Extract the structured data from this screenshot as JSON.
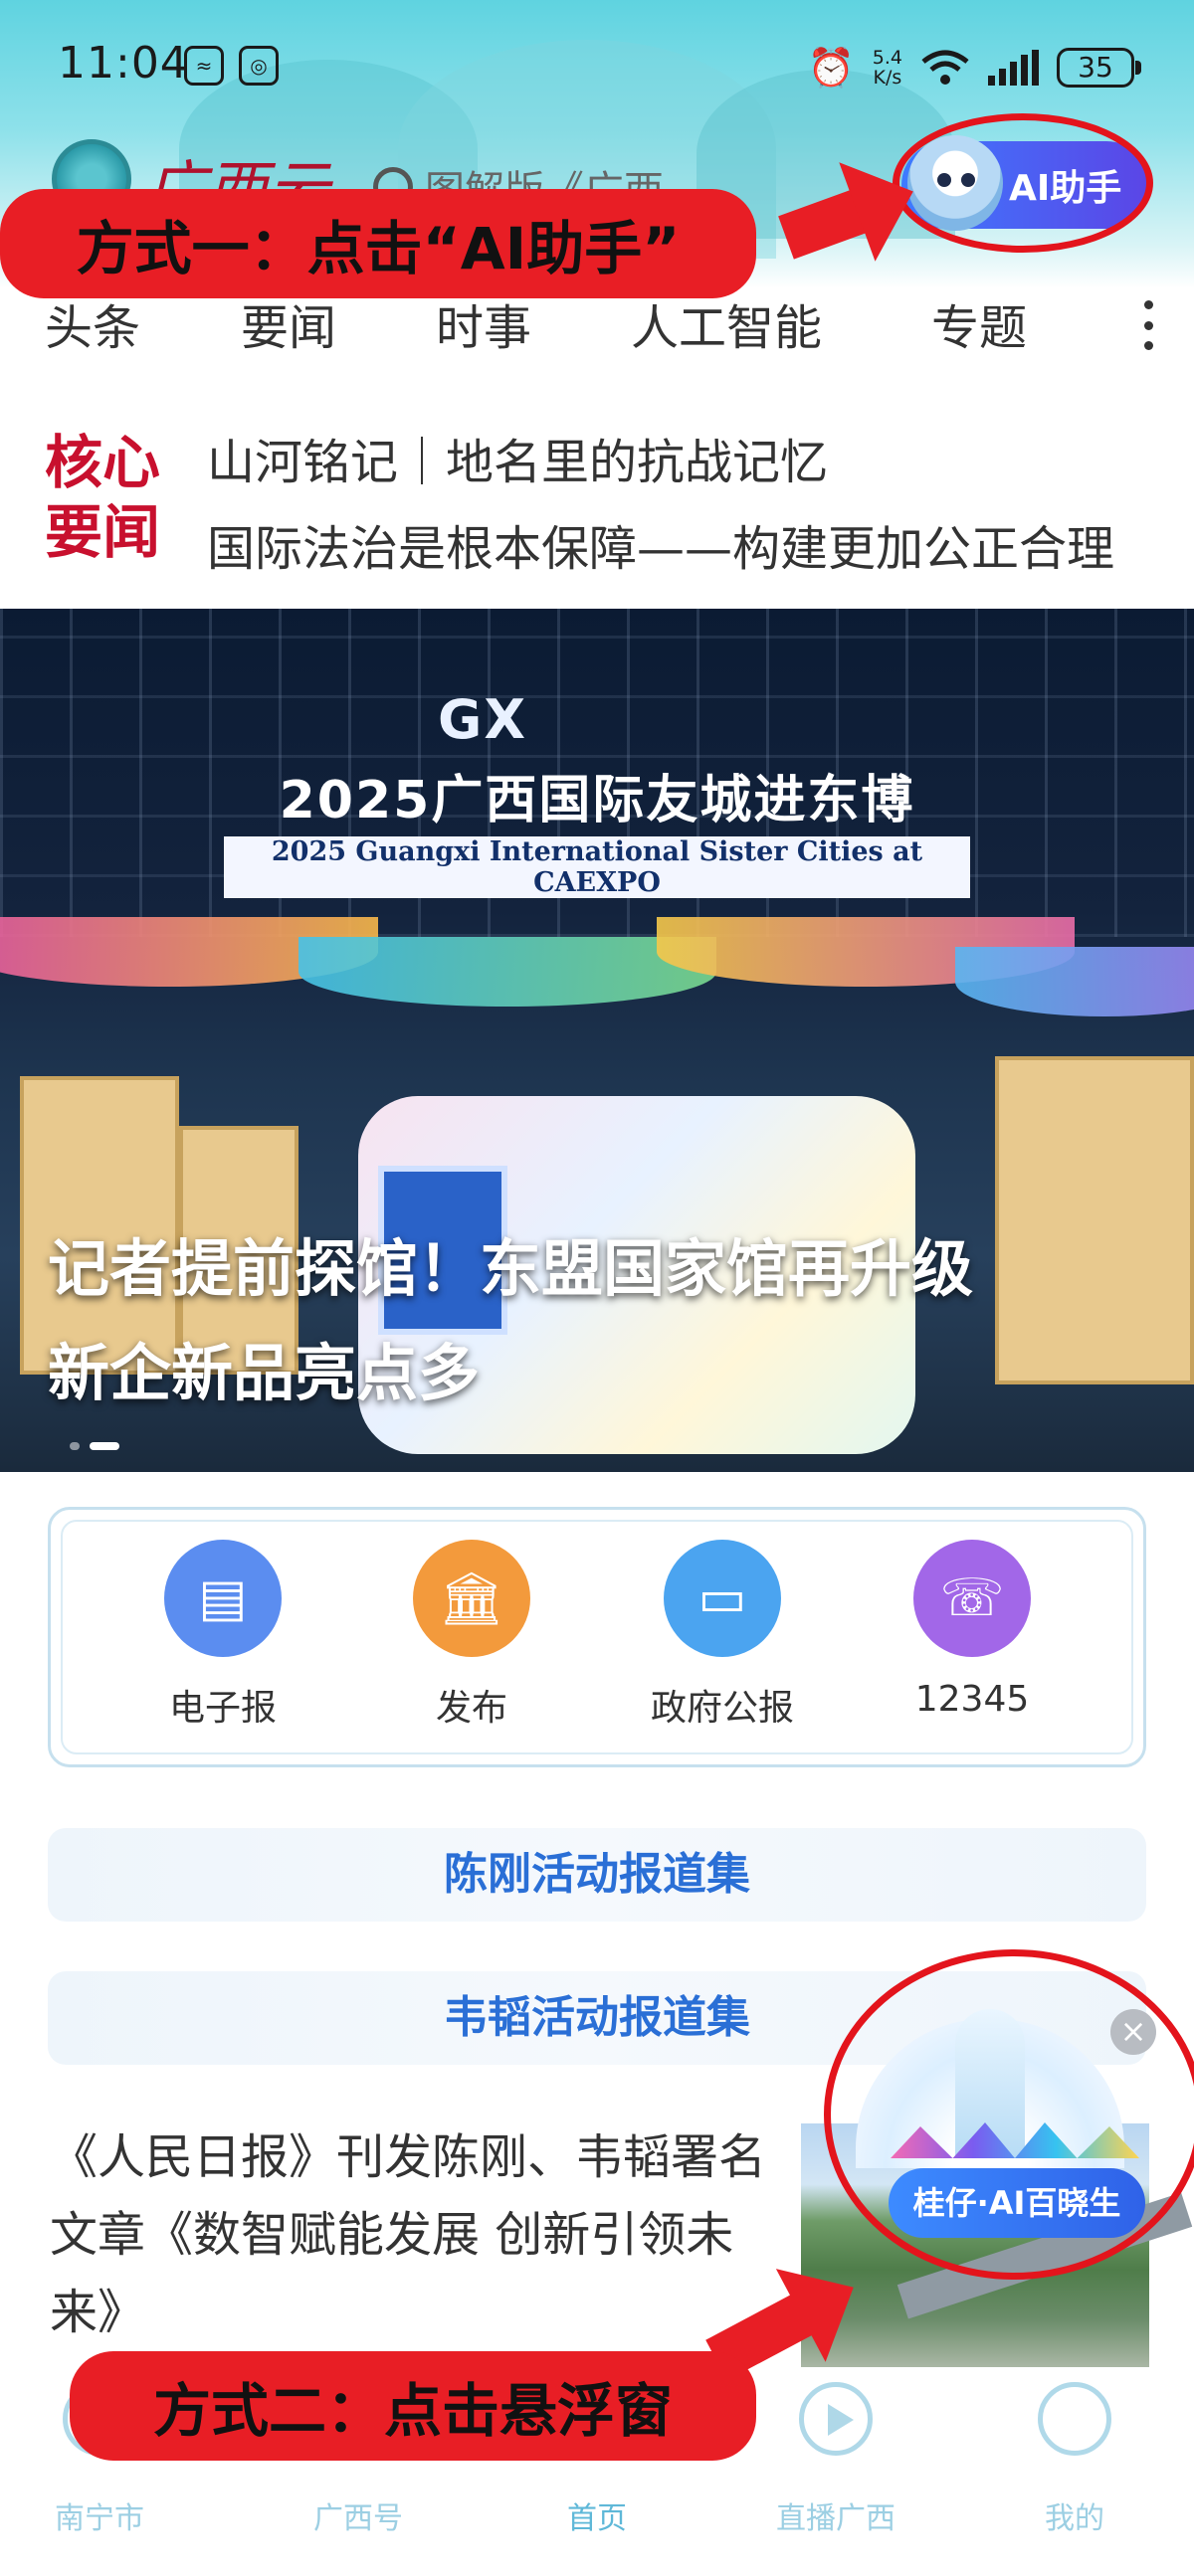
{
  "status_bar": {
    "time": "11:04",
    "net_speed_value": "5.4",
    "net_speed_unit": "K/s",
    "battery": "35"
  },
  "header": {
    "logo_text": "广西云",
    "search_hint": "图解版《广西…",
    "ai_button": "AI助手"
  },
  "nav_tabs": [
    "头条",
    "要闻",
    "时事",
    "人工智能",
    "专题"
  ],
  "core_news": {
    "badge_line1": "核心",
    "badge_line2": "要闻",
    "items": [
      "山河铭记｜地名里的抗战记忆",
      "国际法治是根本保障——构建更加公正合理"
    ]
  },
  "banner": {
    "logo": "GX",
    "sign_title": "2025广西国际友城进东博",
    "sign_subtitle": "2025 Guangxi International Sister Cities at CAEXPO",
    "headline_line1": "记者提前探馆！东盟国家馆再升级",
    "headline_line2": "新企新品亮点多"
  },
  "services": [
    {
      "label": "电子报",
      "icon": "newspaper-icon",
      "color": "#5b8df0"
    },
    {
      "label": "发布",
      "icon": "building-icon",
      "color": "#f39a3c"
    },
    {
      "label": "政府公报",
      "icon": "calendar-icon",
      "color": "#4ba4f0"
    },
    {
      "label": "12345",
      "icon": "phone-house-icon",
      "color": "#a267e8"
    }
  ],
  "reports": {
    "report1": "陈刚活动报道集",
    "report2": "韦韬活动报道集"
  },
  "article": {
    "title": "《人民日报》刊发陈刚、韦韬署名文章《数智赋能发展 创新引领未来》"
  },
  "floating_window": {
    "label": "桂仔·AI百晓生",
    "close": "×"
  },
  "annotations": {
    "method1": "方式一：点击“AI助手”",
    "method2": "方式二：点击悬浮窗"
  },
  "bottom_nav": [
    {
      "label": "南宁市"
    },
    {
      "label": "广西号"
    },
    {
      "label": "首页"
    },
    {
      "label": "直播广西"
    },
    {
      "label": "我的"
    }
  ],
  "colors": {
    "accent": "#3d7bff",
    "brand_red": "#c8102e",
    "annotation_red": "#e81e25",
    "report_blue": "#2a6fd6"
  }
}
